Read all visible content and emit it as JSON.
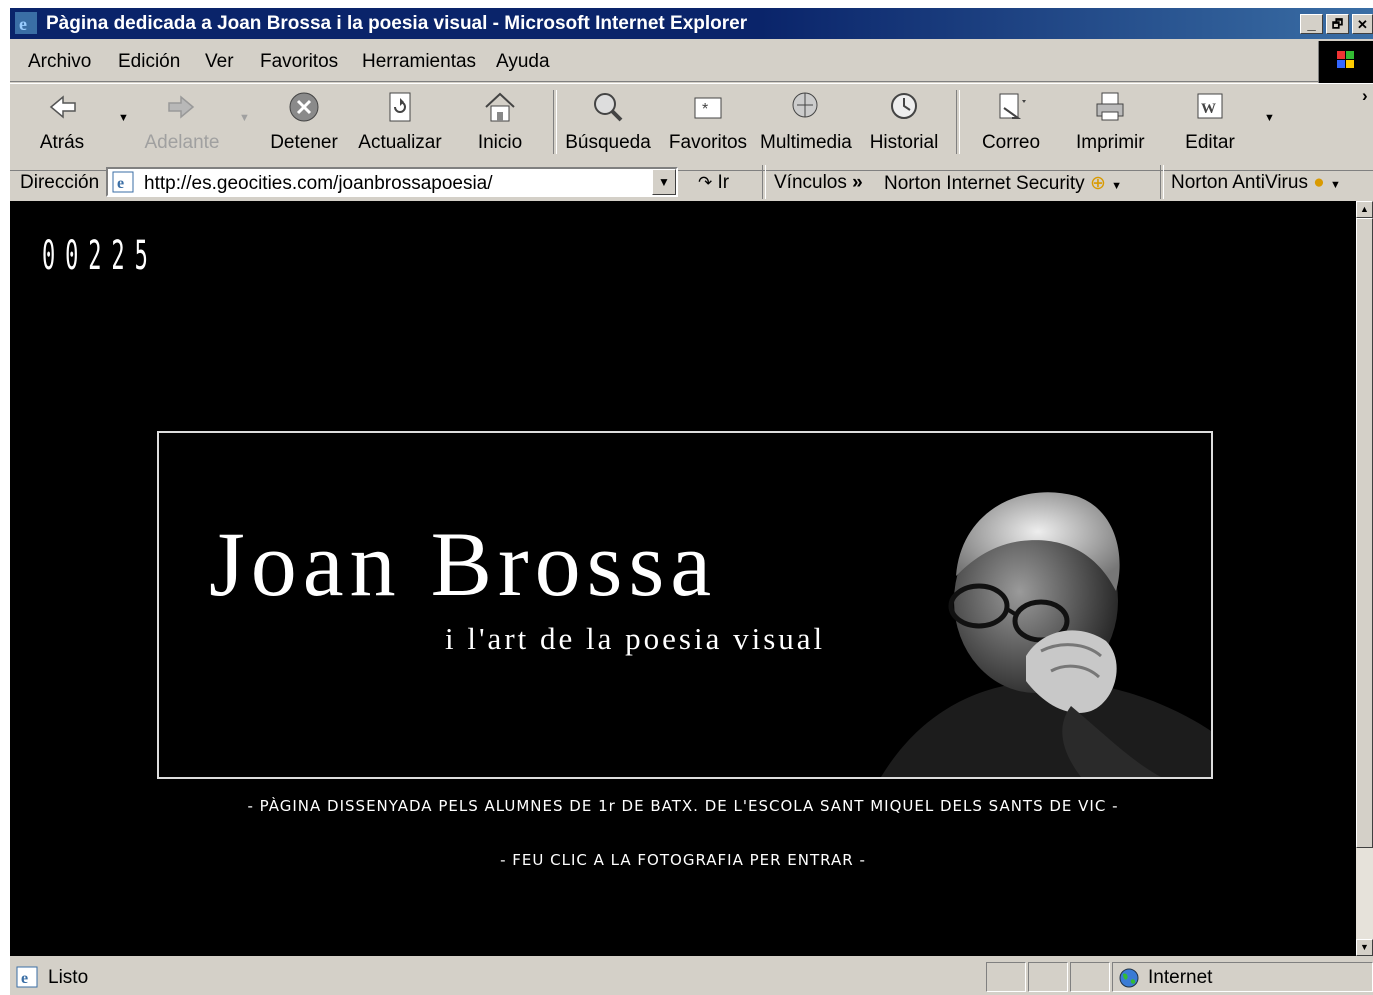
{
  "window": {
    "title": "Pàgina dedicada a Joan Brossa i la poesia visual - Microsoft Internet Explorer",
    "controls": [
      "_",
      "🗗",
      "✕"
    ]
  },
  "menu": [
    "Archivo",
    "Edición",
    "Ver",
    "Favoritos",
    "Herramientas",
    "Ayuda"
  ],
  "toolbar": {
    "back": "Atrás",
    "forward": "Adelante",
    "stop": "Detener",
    "refresh": "Actualizar",
    "home": "Inicio",
    "search": "Búsqueda",
    "favorites": "Favoritos",
    "media": "Multimedia",
    "history": "Historial",
    "mail": "Correo",
    "print": "Imprimir",
    "edit": "Editar",
    "more": "›"
  },
  "address": {
    "label": "Dirección",
    "url": "http://es.geocities.com/joanbrossapoesia/",
    "go": "Ir",
    "links": "Vínculos",
    "norton_security": "Norton Internet Security",
    "norton_antivirus": "Norton AntiVirus"
  },
  "page": {
    "counter": "00225",
    "banner_title": "Joan Brossa",
    "banner_subtitle": "i l'art de la poesia visual",
    "credit": "- PÀGINA DISSENYADA PELS ALUMNES DE 1r DE BATX. DE L'ESCOLA SANT MIQUEL DELS SANTS DE VIC -",
    "enter": "- FEU CLIC A LA FOTOGRAFIA PER ENTRAR -"
  },
  "status": {
    "text": "Listo",
    "zone": "Internet"
  },
  "colors": {
    "titlebar": "#0a246a",
    "chrome": "#d4d0c8",
    "page_bg": "#000000"
  }
}
